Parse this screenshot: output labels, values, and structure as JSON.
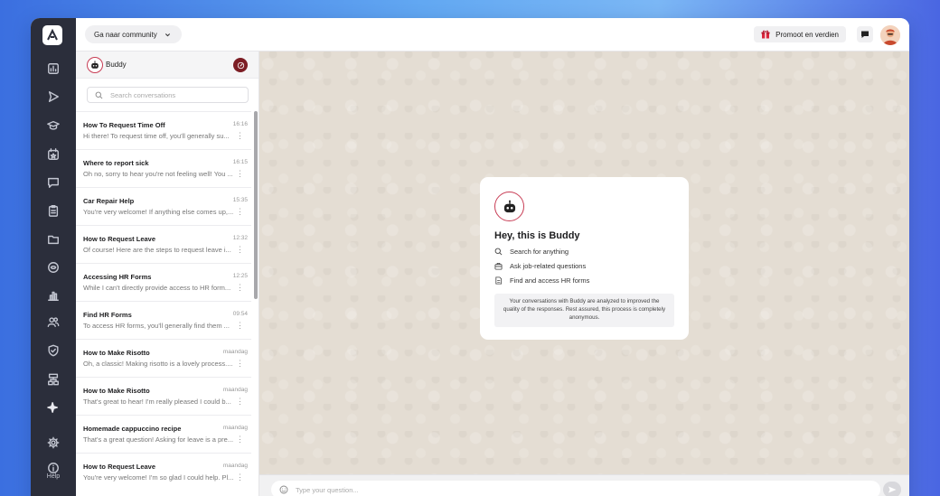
{
  "topbar": {
    "community_label": "Ga naar community",
    "promote_label": "Promoot en verdien"
  },
  "rail": {
    "icons": [
      "dashboard-icon",
      "send-icon",
      "academy-icon",
      "calendar-icon",
      "chat-icon",
      "clipboard-icon",
      "folder-icon",
      "gift-icon",
      "chart-icon",
      "users-icon",
      "shield-icon",
      "org-icon",
      "sparkle-icon",
      "settings-icon",
      "help-icon"
    ],
    "help_label": "Help"
  },
  "sidebar": {
    "assistant_name": "Buddy",
    "search_placeholder": "Search conversations",
    "conversations": [
      {
        "title": "How To Request Time Off",
        "time": "16:16",
        "preview": "Hi there! To request time off, you'll generally su..."
      },
      {
        "title": "Where to report sick",
        "time": "16:15",
        "preview": "Oh no, sorry to hear you're not feeling well! You ..."
      },
      {
        "title": "Car Repair Help",
        "time": "15:35",
        "preview": "You're very welcome! If anything else comes up,..."
      },
      {
        "title": "How to Request Leave",
        "time": "12:32",
        "preview": "Of course! Here are the steps to request leave i..."
      },
      {
        "title": "Accessing HR Forms",
        "time": "12:25",
        "preview": "While I can't directly provide access to HR form..."
      },
      {
        "title": "Find HR Forms",
        "time": "09:54",
        "preview": "To access HR forms, you'll generally find them ..."
      },
      {
        "title": "How to Make Risotto",
        "time": "maandag",
        "preview": "Oh, a classic! Making risotto is a lovely process...."
      },
      {
        "title": "How to Make Risotto",
        "time": "maandag",
        "preview": "That's great to hear! I'm really pleased I could b..."
      },
      {
        "title": "Homemade cappuccino recipe",
        "time": "maandag",
        "preview": "That's a great question! Asking for leave is a pre..."
      },
      {
        "title": "How to Request Leave",
        "time": "maandag",
        "preview": "You're very welcome! I'm so glad I could help. Pl..."
      }
    ]
  },
  "welcome": {
    "heading": "Hey, this is Buddy",
    "features": [
      {
        "icon": "search-icon",
        "label": "Search for anything"
      },
      {
        "icon": "briefcase-icon",
        "label": "Ask job-related questions"
      },
      {
        "icon": "document-icon",
        "label": "Find and access HR forms"
      }
    ],
    "note": "Your conversations with Buddy are analyzed to improved the quality of the responses. Rest assured, this process is completely anonymous."
  },
  "composer": {
    "placeholder": "Type your question..."
  },
  "colors": {
    "rail_bg": "#2b2e3b",
    "accent": "#c83d55",
    "new_chat_bg": "#7c1d24",
    "chat_bg": "#e4ddd3"
  }
}
